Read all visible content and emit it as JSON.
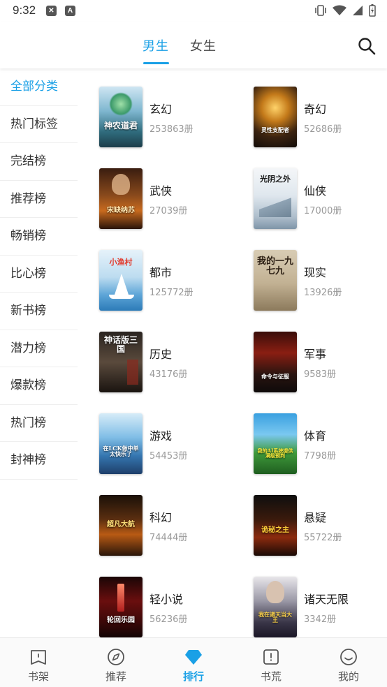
{
  "status": {
    "time": "9:32",
    "left_icons": [
      "shield-x-icon",
      "font-a-icon"
    ],
    "right_icons": [
      "vibrate-icon",
      "wifi-icon",
      "signal-icon",
      "battery-charging-icon"
    ]
  },
  "header": {
    "tabs": [
      {
        "label": "男生",
        "active": true
      },
      {
        "label": "女生",
        "active": false
      }
    ],
    "search_icon": "search-icon"
  },
  "sidebar": {
    "items": [
      {
        "label": "全部分类",
        "active": true
      },
      {
        "label": "热门标签"
      },
      {
        "label": "完结榜"
      },
      {
        "label": "推荐榜"
      },
      {
        "label": "畅销榜"
      },
      {
        "label": "比心榜"
      },
      {
        "label": "新书榜"
      },
      {
        "label": "潜力榜"
      },
      {
        "label": "爆款榜"
      },
      {
        "label": "热门榜"
      },
      {
        "label": "封神榜"
      }
    ]
  },
  "categories": [
    {
      "name": "玄幻",
      "count": "253863册",
      "cover_title": "神农道君"
    },
    {
      "name": "奇幻",
      "count": "52686册",
      "cover_title": "灵性支配者"
    },
    {
      "name": "武侠",
      "count": "27039册",
      "cover_title": "宋缺纳苏"
    },
    {
      "name": "仙侠",
      "count": "17000册",
      "cover_title": "光阴之外"
    },
    {
      "name": "都市",
      "count": "125772册",
      "cover_title": "小渔村"
    },
    {
      "name": "现实",
      "count": "13926册",
      "cover_title": "我的一九七九"
    },
    {
      "name": "历史",
      "count": "43176册",
      "cover_title": "神话版三国"
    },
    {
      "name": "军事",
      "count": "9583册",
      "cover_title": "命令与征服"
    },
    {
      "name": "游戏",
      "count": "54453册",
      "cover_title": "在LCK做中单太快乐了"
    },
    {
      "name": "体育",
      "count": "7798册",
      "cover_title": "我的AI系统提供满级预判"
    },
    {
      "name": "科幻",
      "count": "74444册",
      "cover_title": "超凡大航"
    },
    {
      "name": "悬疑",
      "count": "55722册",
      "cover_title": "诡秘之主"
    },
    {
      "name": "轻小说",
      "count": "56236册",
      "cover_title": "轮回乐园"
    },
    {
      "name": "诸天无限",
      "count": "3342册",
      "cover_title": "我在诸天当大王"
    }
  ],
  "bottom_nav": [
    {
      "label": "书架",
      "icon": "bookshelf-icon"
    },
    {
      "label": "推荐",
      "icon": "compass-icon"
    },
    {
      "label": "排行",
      "icon": "diamond-icon",
      "active": true
    },
    {
      "label": "书荒",
      "icon": "book-alert-icon"
    },
    {
      "label": "我的",
      "icon": "smile-icon"
    }
  ],
  "colors": {
    "accent": "#1aa0e6",
    "text": "#222222",
    "muted": "#999999"
  }
}
